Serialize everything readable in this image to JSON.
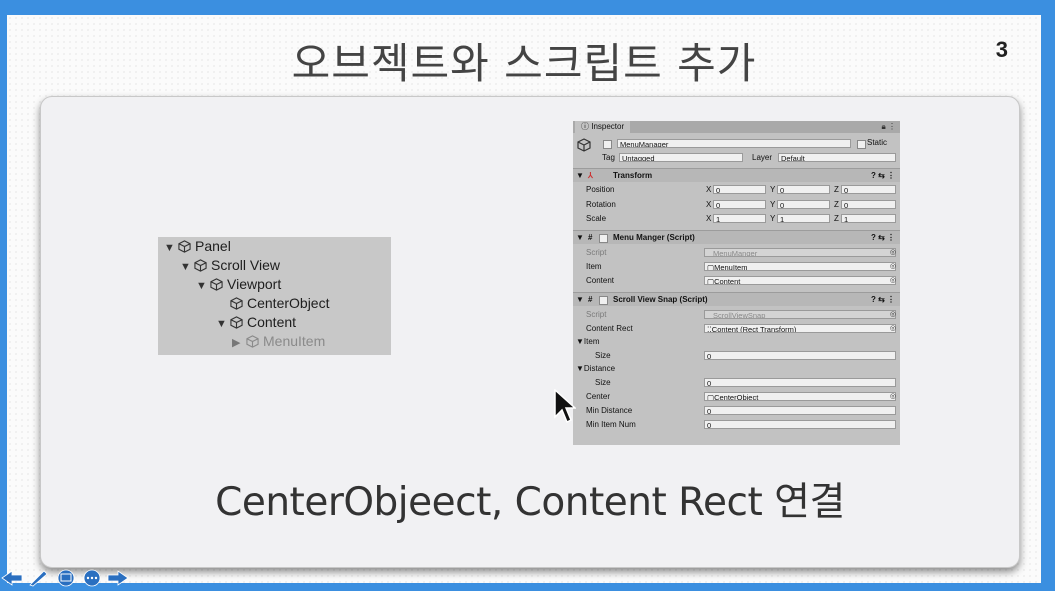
{
  "slide": {
    "title": "오브젝트와 스크립트 추가",
    "number": "3",
    "caption": "CenterObjeect, Content Rect 연결"
  },
  "hierarchy": {
    "items": [
      {
        "label": "Panel",
        "arrow": "▼"
      },
      {
        "label": "Scroll View",
        "arrow": "▼"
      },
      {
        "label": "Viewport",
        "arrow": "▼"
      },
      {
        "label": "CenterObject",
        "arrow": ""
      },
      {
        "label": "Content",
        "arrow": "▼"
      },
      {
        "label": "MenuItem",
        "arrow": "▶"
      }
    ]
  },
  "inspector": {
    "tab_label": "Inspector",
    "tab_controls": "ả ⋮",
    "object_name": "MenuManager",
    "static_label": "Static",
    "tag_label": "Tag",
    "tag_value": "Untagged",
    "layer_label": "Layer",
    "layer_value": "Default",
    "transform": {
      "title": "Transform",
      "position_label": "Position",
      "rotation_label": "Rotation",
      "scale_label": "Scale",
      "x": "X",
      "y": "Y",
      "z": "Z",
      "position": [
        "0",
        "0",
        "0"
      ],
      "rotation": [
        "0",
        "0",
        "0"
      ],
      "scale": [
        "1",
        "1",
        "1"
      ]
    },
    "menu_manager": {
      "title": "Menu Manger (Script)",
      "script_label": "Script",
      "script_value": "MenuManger",
      "item_label": "Item",
      "item_value": "MenuItem",
      "content_label": "Content",
      "content_value": "Content"
    },
    "scroll_snap": {
      "title": "Scroll View Snap (Script)",
      "script_label": "Script",
      "script_value": "ScrollViewSnap",
      "content_rect_label": "Content Rect",
      "content_rect_value": "Content (Rect Transform)",
      "item_label": "Item",
      "size_label": "Size",
      "item_size": "0",
      "distance_label": "Distance",
      "distance_size": "0",
      "center_label": "Center",
      "center_value": "CenterObject",
      "min_distance_label": "Min Distance",
      "min_distance_value": "0",
      "min_item_num_label": "Min Item Num",
      "min_item_num_value": "0"
    }
  },
  "colors": {
    "background": "#3b8fe0",
    "slide": "#fbfbfb",
    "panel": "#f1f1f3",
    "inspector": "#c2c2c2"
  }
}
